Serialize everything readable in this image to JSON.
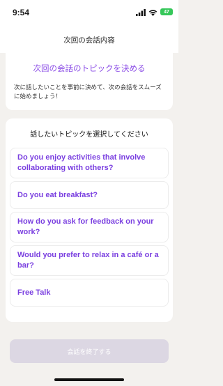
{
  "status": {
    "time": "9:54",
    "battery": "47"
  },
  "header": {
    "title": "次回の会話内容"
  },
  "intro": {
    "title": "次回の会話のトピックを決める",
    "description": "次に話したいことを事前に決めて、次の会話をスムーズに始めましょう！"
  },
  "topics": {
    "heading": "話したいトピックを選択してください",
    "items": [
      {
        "label": "Do you enjoy activities that involve collaborating with others?"
      },
      {
        "label": "Do you eat breakfast?"
      },
      {
        "label": "How do you ask for feedback on your work?"
      },
      {
        "label": "Would you prefer to relax in a café or a bar?"
      },
      {
        "label": "Free Talk"
      }
    ]
  },
  "footer": {
    "end_button": "会話を終了する"
  },
  "colors": {
    "accent": "#7a3fe0",
    "disabled": "#dcd7e3",
    "background": "#f3f1ee"
  },
  "icons": [
    "signal-icon",
    "wifi-icon",
    "battery-icon"
  ]
}
